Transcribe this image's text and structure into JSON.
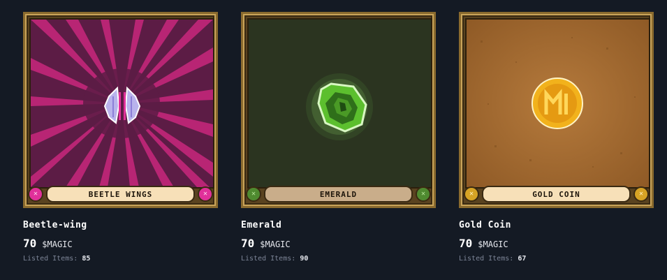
{
  "items": [
    {
      "plate_label": "BEETLE WINGS",
      "title": "Beetle-wing",
      "price": "70",
      "currency": "$MAGIC",
      "listed_label": "Listed Items:",
      "listed_count": "85",
      "colors": {
        "bg": "#5c1c45",
        "accent": "#c2277a",
        "plate": "#f7e0b8",
        "gem": "#e0309a"
      }
    },
    {
      "plate_label": "EMERALD",
      "title": "Emerald",
      "price": "70",
      "currency": "$MAGIC",
      "listed_label": "Listed Items:",
      "listed_count": "90",
      "colors": {
        "bg": "#2b3420",
        "accent": "#5cbf2e",
        "plate": "#c9ad8a",
        "gem": "#4f8a30"
      }
    },
    {
      "plate_label": "GOLD COIN",
      "title": "Gold Coin",
      "price": "70",
      "currency": "$MAGIC",
      "listed_label": "Listed Items:",
      "listed_count": "67",
      "colors": {
        "bg": "#a86e34",
        "accent": "#f2b21c",
        "plate": "#f7e0b8",
        "gem": "#d6a325"
      }
    }
  ]
}
